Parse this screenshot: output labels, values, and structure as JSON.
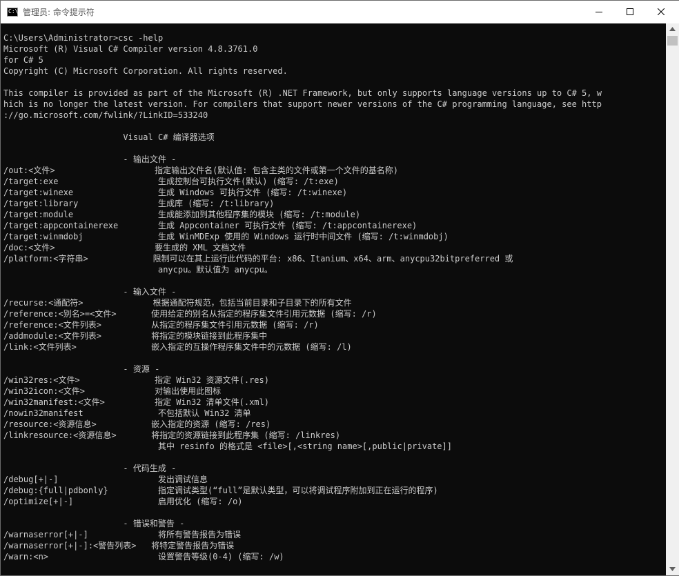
{
  "window": {
    "title": "管理员: 命令提示符",
    "icon_text": "C:\\"
  },
  "controls": {
    "minimize_icon": "minimize-icon",
    "maximize_icon": "maximize-icon",
    "close_icon": "close-icon"
  },
  "console": {
    "lines": [
      "C:\\Users\\Administrator>csc -help",
      "Microsoft (R) Visual C# Compiler version 4.8.3761.0",
      "for C# 5",
      "Copyright (C) Microsoft Corporation. All rights reserved.",
      "",
      "This compiler is provided as part of the Microsoft (R) .NET Framework, but only supports language versions up to C# 5, w",
      "hich is no longer the latest version. For compilers that support newer versions of the C# programming language, see http",
      "://go.microsoft.com/fwlink/?LinkID=533240",
      "",
      "                        Visual C# 编译器选项",
      "",
      "                        - 输出文件 -",
      "/out:<文件>                    指定输出文件名(默认值: 包含主类的文件或第一个文件的基名称)",
      "/target:exe                    生成控制台可执行文件(默认) (缩写: /t:exe)",
      "/target:winexe                 生成 Windows 可执行文件 (缩写: /t:winexe)",
      "/target:library                生成库 (缩写: /t:library)",
      "/target:module                 生成能添加到其他程序集的模块 (缩写: /t:module)",
      "/target:appcontainerexe        生成 Appcontainer 可执行文件 (缩写: /t:appcontainerexe)",
      "/target:winmdobj               生成 WinMDExp 使用的 Windows 运行时中间文件 (缩写: /t:winmdobj)",
      "/doc:<文件>                    要生成的 XML 文档文件",
      "/platform:<字符串>             限制可以在其上运行此代码的平台: x86、Itanium、x64、arm、anycpu32bitpreferred 或",
      "                               anycpu。默认值为 anycpu。",
      "",
      "                        - 输入文件 -",
      "/recurse:<通配符>              根据通配符规范，包括当前目录和子目录下的所有文件",
      "/reference:<别名>=<文件>       使用给定的别名从指定的程序集文件引用元数据 (缩写: /r)",
      "/reference:<文件列表>          从指定的程序集文件引用元数据 (缩写: /r)",
      "/addmodule:<文件列表>          将指定的模块链接到此程序集中",
      "/link:<文件列表>               嵌入指定的互操作程序集文件中的元数据 (缩写: /l)",
      "",
      "                        - 资源 -",
      "/win32res:<文件>               指定 Win32 资源文件(.res)",
      "/win32icon:<文件>              对输出使用此图标",
      "/win32manifest:<文件>          指定 Win32 清单文件(.xml)",
      "/nowin32manifest               不包括默认 Win32 清单",
      "/resource:<资源信息>           嵌入指定的资源 (缩写: /res)",
      "/linkresource:<资源信息>       将指定的资源链接到此程序集 (缩写: /linkres)",
      "                               其中 resinfo 的格式是 <file>[,<string name>[,public|private]]",
      "",
      "                        - 代码生成 -",
      "/debug[+|-]                    发出调试信息",
      "/debug:{full|pdbonly}          指定调试类型(“full”是默认类型，可以将调试程序附加到正在运行的程序)",
      "/optimize[+|-]                 启用优化 (缩写: /o)",
      "",
      "                        - 错误和警告 -",
      "/warnaserror[+|-]              将所有警告报告为错误",
      "/warnaserror[+|-]:<警告列表>   将特定警告报告为错误",
      "/warn:<n>                      设置警告等级(0-4) (缩写: /w)"
    ]
  }
}
